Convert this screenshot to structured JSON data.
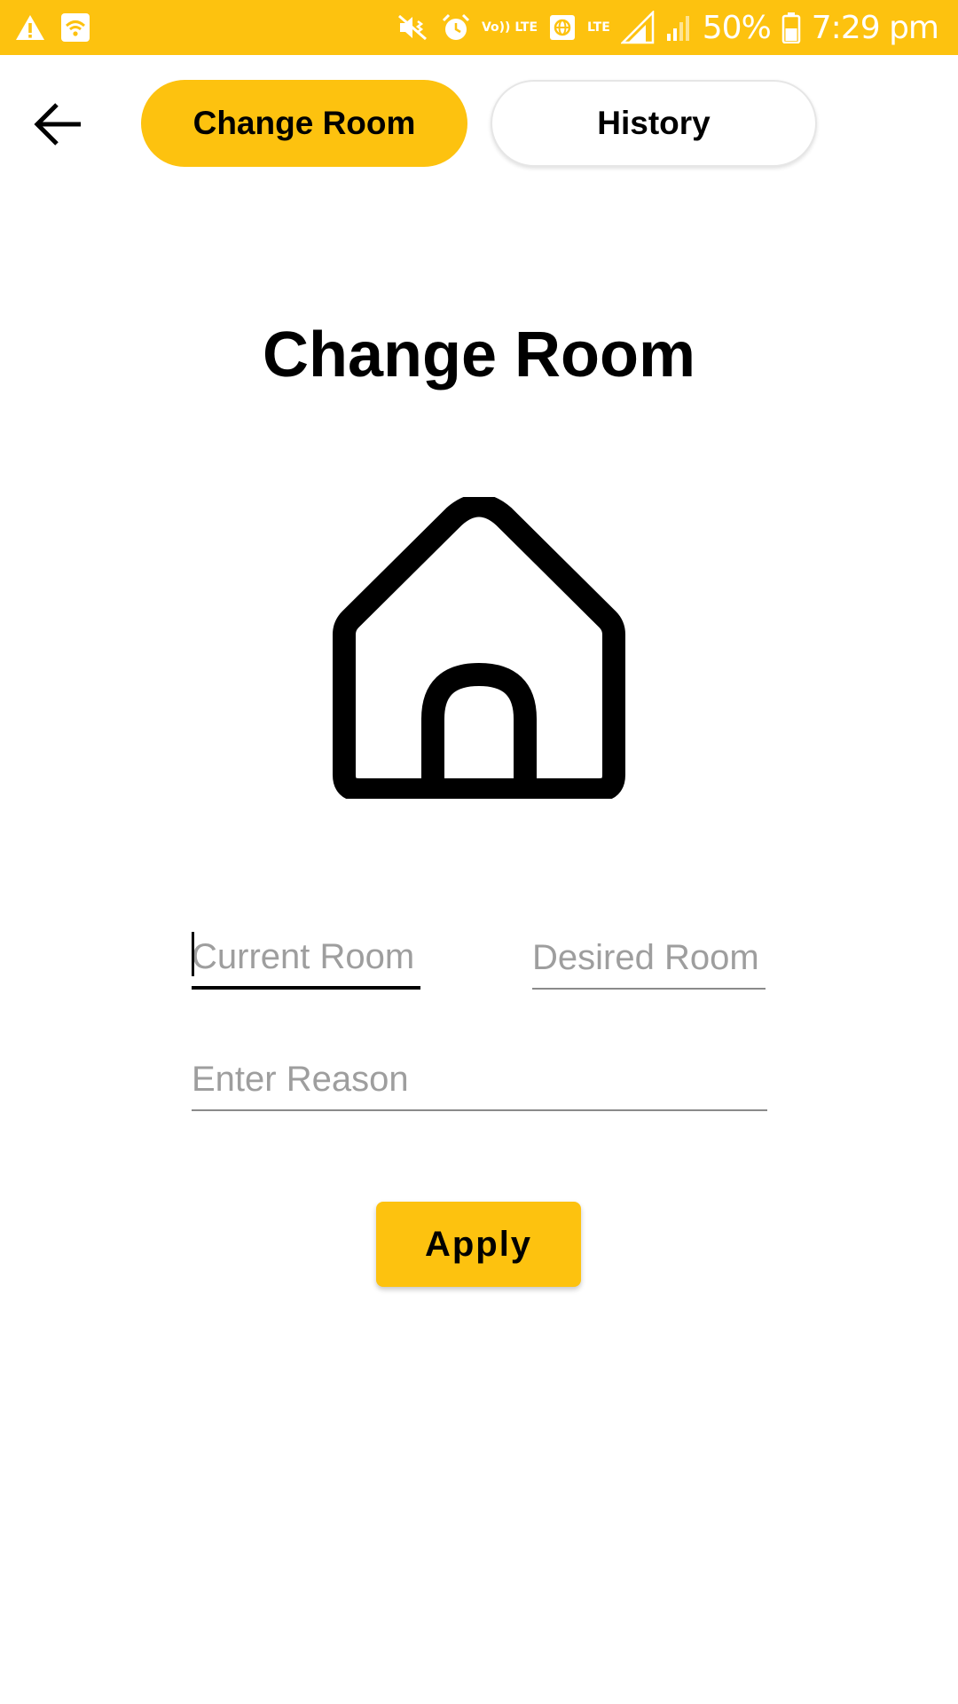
{
  "status_bar": {
    "time": "7:29 pm",
    "battery": "50%",
    "volte_label": "Vo)) LTE",
    "lte_label": "LTE",
    "icons": [
      "warning-icon",
      "wifi-icon",
      "mute-icon",
      "alarm-icon",
      "volte-icon",
      "data-saver-icon",
      "lte-signal-icon",
      "signal-icon",
      "battery-icon"
    ]
  },
  "header": {
    "back_icon": "arrow-left-icon",
    "tabs": [
      {
        "label": "Change Room",
        "active": true
      },
      {
        "label": "History",
        "active": false
      }
    ]
  },
  "main": {
    "title": "Change Room",
    "icon": "house-icon",
    "form": {
      "current_room": {
        "value": "",
        "placeholder": "Current Room"
      },
      "desired_room": {
        "value": "",
        "placeholder": "Desired Room"
      },
      "reason": {
        "value": "",
        "placeholder": "Enter Reason"
      }
    },
    "apply_label": "Apply"
  },
  "colors": {
    "accent": "#FDC20F",
    "text": "#000000",
    "placeholder": "#9E9E9E",
    "underline": "#8A8A8A"
  }
}
